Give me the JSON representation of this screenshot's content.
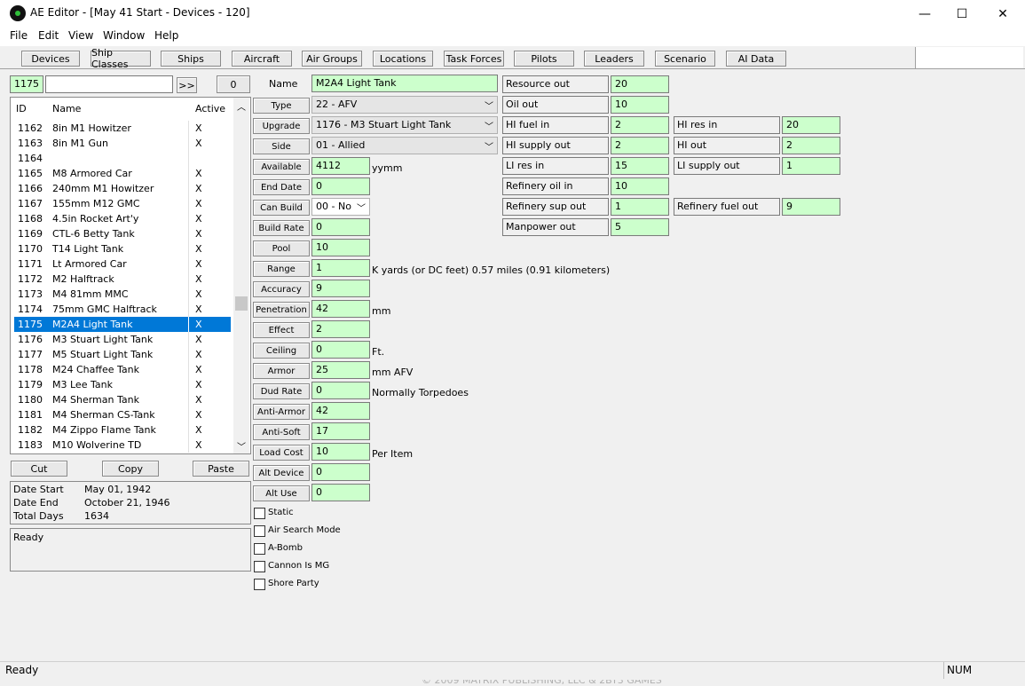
{
  "window": {
    "title": "AE Editor - [May 41 Start - Devices - 120]",
    "minimize": "—",
    "maximize": "☐",
    "close": "✕"
  },
  "menu": [
    "File",
    "Edit",
    "View",
    "Window",
    "Help"
  ],
  "toolbar": [
    "Devices",
    "Ship Classes",
    "Ships",
    "Aircraft",
    "Air Groups",
    "Locations",
    "Task Forces",
    "Pilots",
    "Leaders",
    "Scenario",
    "AI Data"
  ],
  "search": {
    "id_value": "1175",
    "text_value": "",
    "go_label": ">>",
    "count": "0"
  },
  "list": {
    "headers": {
      "id": "ID",
      "name": "Name",
      "active": "Active"
    },
    "rows": [
      {
        "id": "1162",
        "name": "8in M1 Howitzer",
        "active": "X"
      },
      {
        "id": "1163",
        "name": "8in M1 Gun",
        "active": "X"
      },
      {
        "id": "1164",
        "name": "",
        "active": ""
      },
      {
        "id": "1165",
        "name": "M8 Armored Car",
        "active": "X"
      },
      {
        "id": "1166",
        "name": "240mm M1 Howitzer",
        "active": "X"
      },
      {
        "id": "1167",
        "name": "155mm M12 GMC",
        "active": "X"
      },
      {
        "id": "1168",
        "name": "4.5in Rocket Art'y",
        "active": "X"
      },
      {
        "id": "1169",
        "name": "CTL-6 Betty Tank",
        "active": "X"
      },
      {
        "id": "1170",
        "name": "T14 Light Tank",
        "active": "X"
      },
      {
        "id": "1171",
        "name": "Lt Armored Car",
        "active": "X"
      },
      {
        "id": "1172",
        "name": "M2 Halftrack",
        "active": "X"
      },
      {
        "id": "1173",
        "name": "M4 81mm MMC",
        "active": "X"
      },
      {
        "id": "1174",
        "name": "75mm GMC Halftrack",
        "active": "X"
      },
      {
        "id": "1175",
        "name": "M2A4 Light Tank",
        "active": "X"
      },
      {
        "id": "1176",
        "name": "M3 Stuart Light Tank",
        "active": "X"
      },
      {
        "id": "1177",
        "name": "M5 Stuart Light Tank",
        "active": "X"
      },
      {
        "id": "1178",
        "name": "M24 Chaffee Tank",
        "active": "X"
      },
      {
        "id": "1179",
        "name": "M3 Lee Tank",
        "active": "X"
      },
      {
        "id": "1180",
        "name": "M4 Sherman Tank",
        "active": "X"
      },
      {
        "id": "1181",
        "name": "M4 Sherman CS-Tank",
        "active": "X"
      },
      {
        "id": "1182",
        "name": "M4 Zippo Flame Tank",
        "active": "X"
      },
      {
        "id": "1183",
        "name": "M10 Wolverine TD",
        "active": "X"
      }
    ],
    "selected_id": "1175"
  },
  "edit_buttons": {
    "cut": "Cut",
    "copy": "Copy",
    "paste": "Paste"
  },
  "dates": {
    "start_label": "Date Start",
    "start_value": "May 01, 1942",
    "end_label": "Date End",
    "end_value": "October 21, 1946",
    "total_label": "Total Days",
    "total_value": "1634"
  },
  "log_text": "Ready",
  "device": {
    "name_label": "Name",
    "name_value": "M2A4 Light Tank",
    "type_label": "Type",
    "type_value": "22 - AFV",
    "upgrade_label": "Upgrade",
    "upgrade_value": "1176 - M3 Stuart Light Tank",
    "side_label": "Side",
    "side_value": "01 - Allied",
    "available_label": "Available",
    "available_value": "4112",
    "available_unit": "yymm",
    "end_date_label": "End Date",
    "end_date_value": "0",
    "can_build_label": "Can Build",
    "can_build_value": "00 - No",
    "build_rate_label": "Build Rate",
    "build_rate_value": "0",
    "pool_label": "Pool",
    "pool_value": "10",
    "range_label": "Range",
    "range_value": "1",
    "range_unit": "K yards  (or DC feet)  0.57 miles  (0.91 kilometers)",
    "accuracy_label": "Accuracy",
    "accuracy_value": "9",
    "penetration_label": "Penetration",
    "penetration_value": "42",
    "penetration_unit": "mm",
    "effect_label": "Effect",
    "effect_value": "2",
    "ceiling_label": "Ceiling",
    "ceiling_value": "0",
    "ceiling_unit": "Ft.",
    "armor_label": "Armor",
    "armor_value": "25",
    "armor_unit": "mm AFV",
    "dud_rate_label": "Dud Rate",
    "dud_rate_value": "0",
    "dud_rate_unit": "Normally Torpedoes",
    "anti_armor_label": "Anti-Armor",
    "anti_armor_value": "42",
    "anti_soft_label": "Anti-Soft",
    "anti_soft_value": "17",
    "load_cost_label": "Load Cost",
    "load_cost_value": "10",
    "load_cost_unit": "Per Item",
    "alt_device_label": "Alt Device",
    "alt_device_value": "0",
    "alt_use_label": "Alt Use",
    "alt_use_value": "0"
  },
  "flags": [
    "Static",
    "Air Search Mode",
    "A-Bomb",
    "Cannon Is MG",
    "Shore Party"
  ],
  "resources": {
    "resource_out_label": "Resource out",
    "resource_out_value": "20",
    "oil_out_label": "Oil out",
    "oil_out_value": "10",
    "hi_fuel_in_label": "HI fuel in",
    "hi_fuel_in_value": "2",
    "hi_res_in_label": "HI res in",
    "hi_res_in_value": "20",
    "hi_supply_out_label": "HI supply out",
    "hi_supply_out_value": "2",
    "hi_out_label": "HI out",
    "hi_out_value": "2",
    "li_res_in_label": "LI res in",
    "li_res_in_value": "15",
    "li_supply_out_label": "LI supply out",
    "li_supply_out_value": "1",
    "refinery_oil_in_label": "Refinery oil in",
    "refinery_oil_in_value": "10",
    "refinery_sup_out_label": "Refinery sup out",
    "refinery_sup_out_value": "1",
    "refinery_fuel_out_label": "Refinery fuel out",
    "refinery_fuel_out_value": "9",
    "manpower_out_label": "Manpower out",
    "manpower_out_value": "5"
  },
  "status": {
    "text": "Ready",
    "num": "NUM",
    "watermark": "© 2009 MATRIX PUBLISHING, LLC & 2BY3 GAMES"
  },
  "colors": {
    "field_green": "#ccffcc",
    "selection": "#0078d7"
  }
}
